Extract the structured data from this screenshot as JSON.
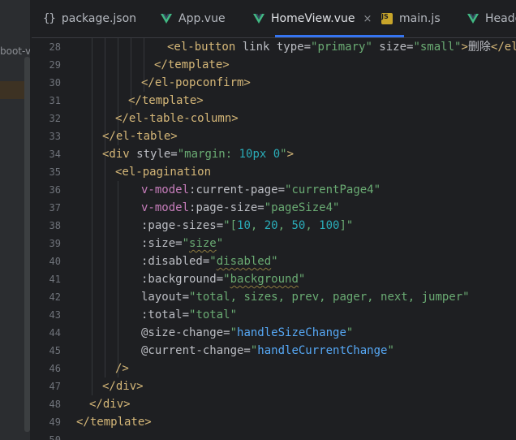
{
  "sidebar": {
    "project_label": "boot-v"
  },
  "tabs": [
    {
      "label": "package.json",
      "icon": "json-braces-icon",
      "active": false
    },
    {
      "label": "App.vue",
      "icon": "vue-logo-icon",
      "active": false
    },
    {
      "label": "HomeView.vue",
      "icon": "vue-logo-icon",
      "active": true,
      "close": "×"
    },
    {
      "label": "main.js",
      "icon": "js-file-icon",
      "active": false
    },
    {
      "label": "Heade",
      "icon": "vue-logo-icon",
      "active": false
    }
  ],
  "colors": {
    "tag": "#d5b778",
    "attribute": "#bcbec4",
    "string": "#6aab73",
    "vue_directive": "#c77dbb",
    "number": "#2aacb8",
    "handler": "#56a8f5",
    "accent": "#3574f0",
    "background": "#1e1f22"
  },
  "lines": [
    {
      "n": "28",
      "tokens": [
        [
          "tag",
          "<el-button "
        ],
        [
          "attr",
          "link type="
        ],
        [
          "val",
          "\"primary\""
        ],
        [
          "attr",
          " size="
        ],
        [
          "val",
          "\"small\""
        ],
        [
          "tag",
          ">"
        ],
        [
          "txt",
          "删除"
        ],
        [
          "tag",
          "</el-"
        ]
      ]
    },
    {
      "n": "29",
      "tokens": [
        [
          "tag",
          "</template>"
        ]
      ]
    },
    {
      "n": "30",
      "tokens": [
        [
          "tag",
          "</el-popconfirm>"
        ]
      ]
    },
    {
      "n": "31",
      "tokens": [
        [
          "tag",
          "</template>"
        ]
      ]
    },
    {
      "n": "32",
      "tokens": [
        [
          "tag",
          "</el-table-column>"
        ]
      ]
    },
    {
      "n": "33",
      "tokens": [
        [
          "tag",
          "</el-table>"
        ]
      ]
    },
    {
      "n": "34",
      "tokens": [
        [
          "tag",
          "<div "
        ],
        [
          "attr",
          "style="
        ],
        [
          "val",
          "\"margin: "
        ],
        [
          "num",
          "10px 0"
        ],
        [
          "val",
          "\""
        ],
        [
          "tag",
          ">"
        ]
      ]
    },
    {
      "n": "35",
      "tokens": [
        [
          "tag",
          "<el-pagination"
        ]
      ]
    },
    {
      "n": "36",
      "tokens": [
        [
          "vbind",
          "v-model"
        ],
        [
          "attr",
          ":current-page="
        ],
        [
          "val",
          "\"currentPage4\""
        ]
      ]
    },
    {
      "n": "37",
      "tokens": [
        [
          "vbind",
          "v-model"
        ],
        [
          "attr",
          ":page-size="
        ],
        [
          "val",
          "\"pageSize4\""
        ]
      ]
    },
    {
      "n": "38",
      "tokens": [
        [
          "attr",
          ":page-sizes="
        ],
        [
          "val",
          "\"["
        ],
        [
          "num",
          "10"
        ],
        [
          "val",
          ", "
        ],
        [
          "num",
          "20"
        ],
        [
          "val",
          ", "
        ],
        [
          "num",
          "50"
        ],
        [
          "val",
          ", "
        ],
        [
          "num",
          "100"
        ],
        [
          "val",
          "]\""
        ]
      ]
    },
    {
      "n": "39",
      "tokens": [
        [
          "attr",
          ":size="
        ],
        [
          "val",
          "\""
        ],
        [
          "wavy",
          "size"
        ],
        [
          "val",
          "\""
        ]
      ]
    },
    {
      "n": "40",
      "tokens": [
        [
          "attr",
          ":disabled="
        ],
        [
          "val",
          "\""
        ],
        [
          "wavy",
          "disabled"
        ],
        [
          "val",
          "\""
        ]
      ]
    },
    {
      "n": "41",
      "tokens": [
        [
          "attr",
          ":background="
        ],
        [
          "val",
          "\""
        ],
        [
          "wavy",
          "background"
        ],
        [
          "val",
          "\""
        ]
      ]
    },
    {
      "n": "42",
      "tokens": [
        [
          "attr",
          "layout="
        ],
        [
          "val",
          "\"total, sizes, prev, pager, next, jumper\""
        ]
      ]
    },
    {
      "n": "43",
      "tokens": [
        [
          "attr",
          ":total="
        ],
        [
          "val",
          "\"total\""
        ]
      ]
    },
    {
      "n": "44",
      "tokens": [
        [
          "attr",
          "@size-change="
        ],
        [
          "val",
          "\""
        ],
        [
          "fn",
          "handleSizeChange"
        ],
        [
          "val",
          "\""
        ]
      ]
    },
    {
      "n": "45",
      "tokens": [
        [
          "attr",
          "@current-change="
        ],
        [
          "val",
          "\""
        ],
        [
          "fn",
          "handleCurrentChange"
        ],
        [
          "val",
          "\""
        ]
      ]
    },
    {
      "n": "46",
      "tokens": [
        [
          "tag",
          "/>"
        ]
      ]
    },
    {
      "n": "47",
      "tokens": [
        [
          "tag",
          "</div>"
        ]
      ]
    },
    {
      "n": "48",
      "tokens": [
        [
          "tag",
          "</div>"
        ]
      ]
    },
    {
      "n": "49",
      "tokens": [
        [
          "tag",
          "</template>"
        ]
      ]
    },
    {
      "n": "50",
      "tokens": []
    }
  ]
}
